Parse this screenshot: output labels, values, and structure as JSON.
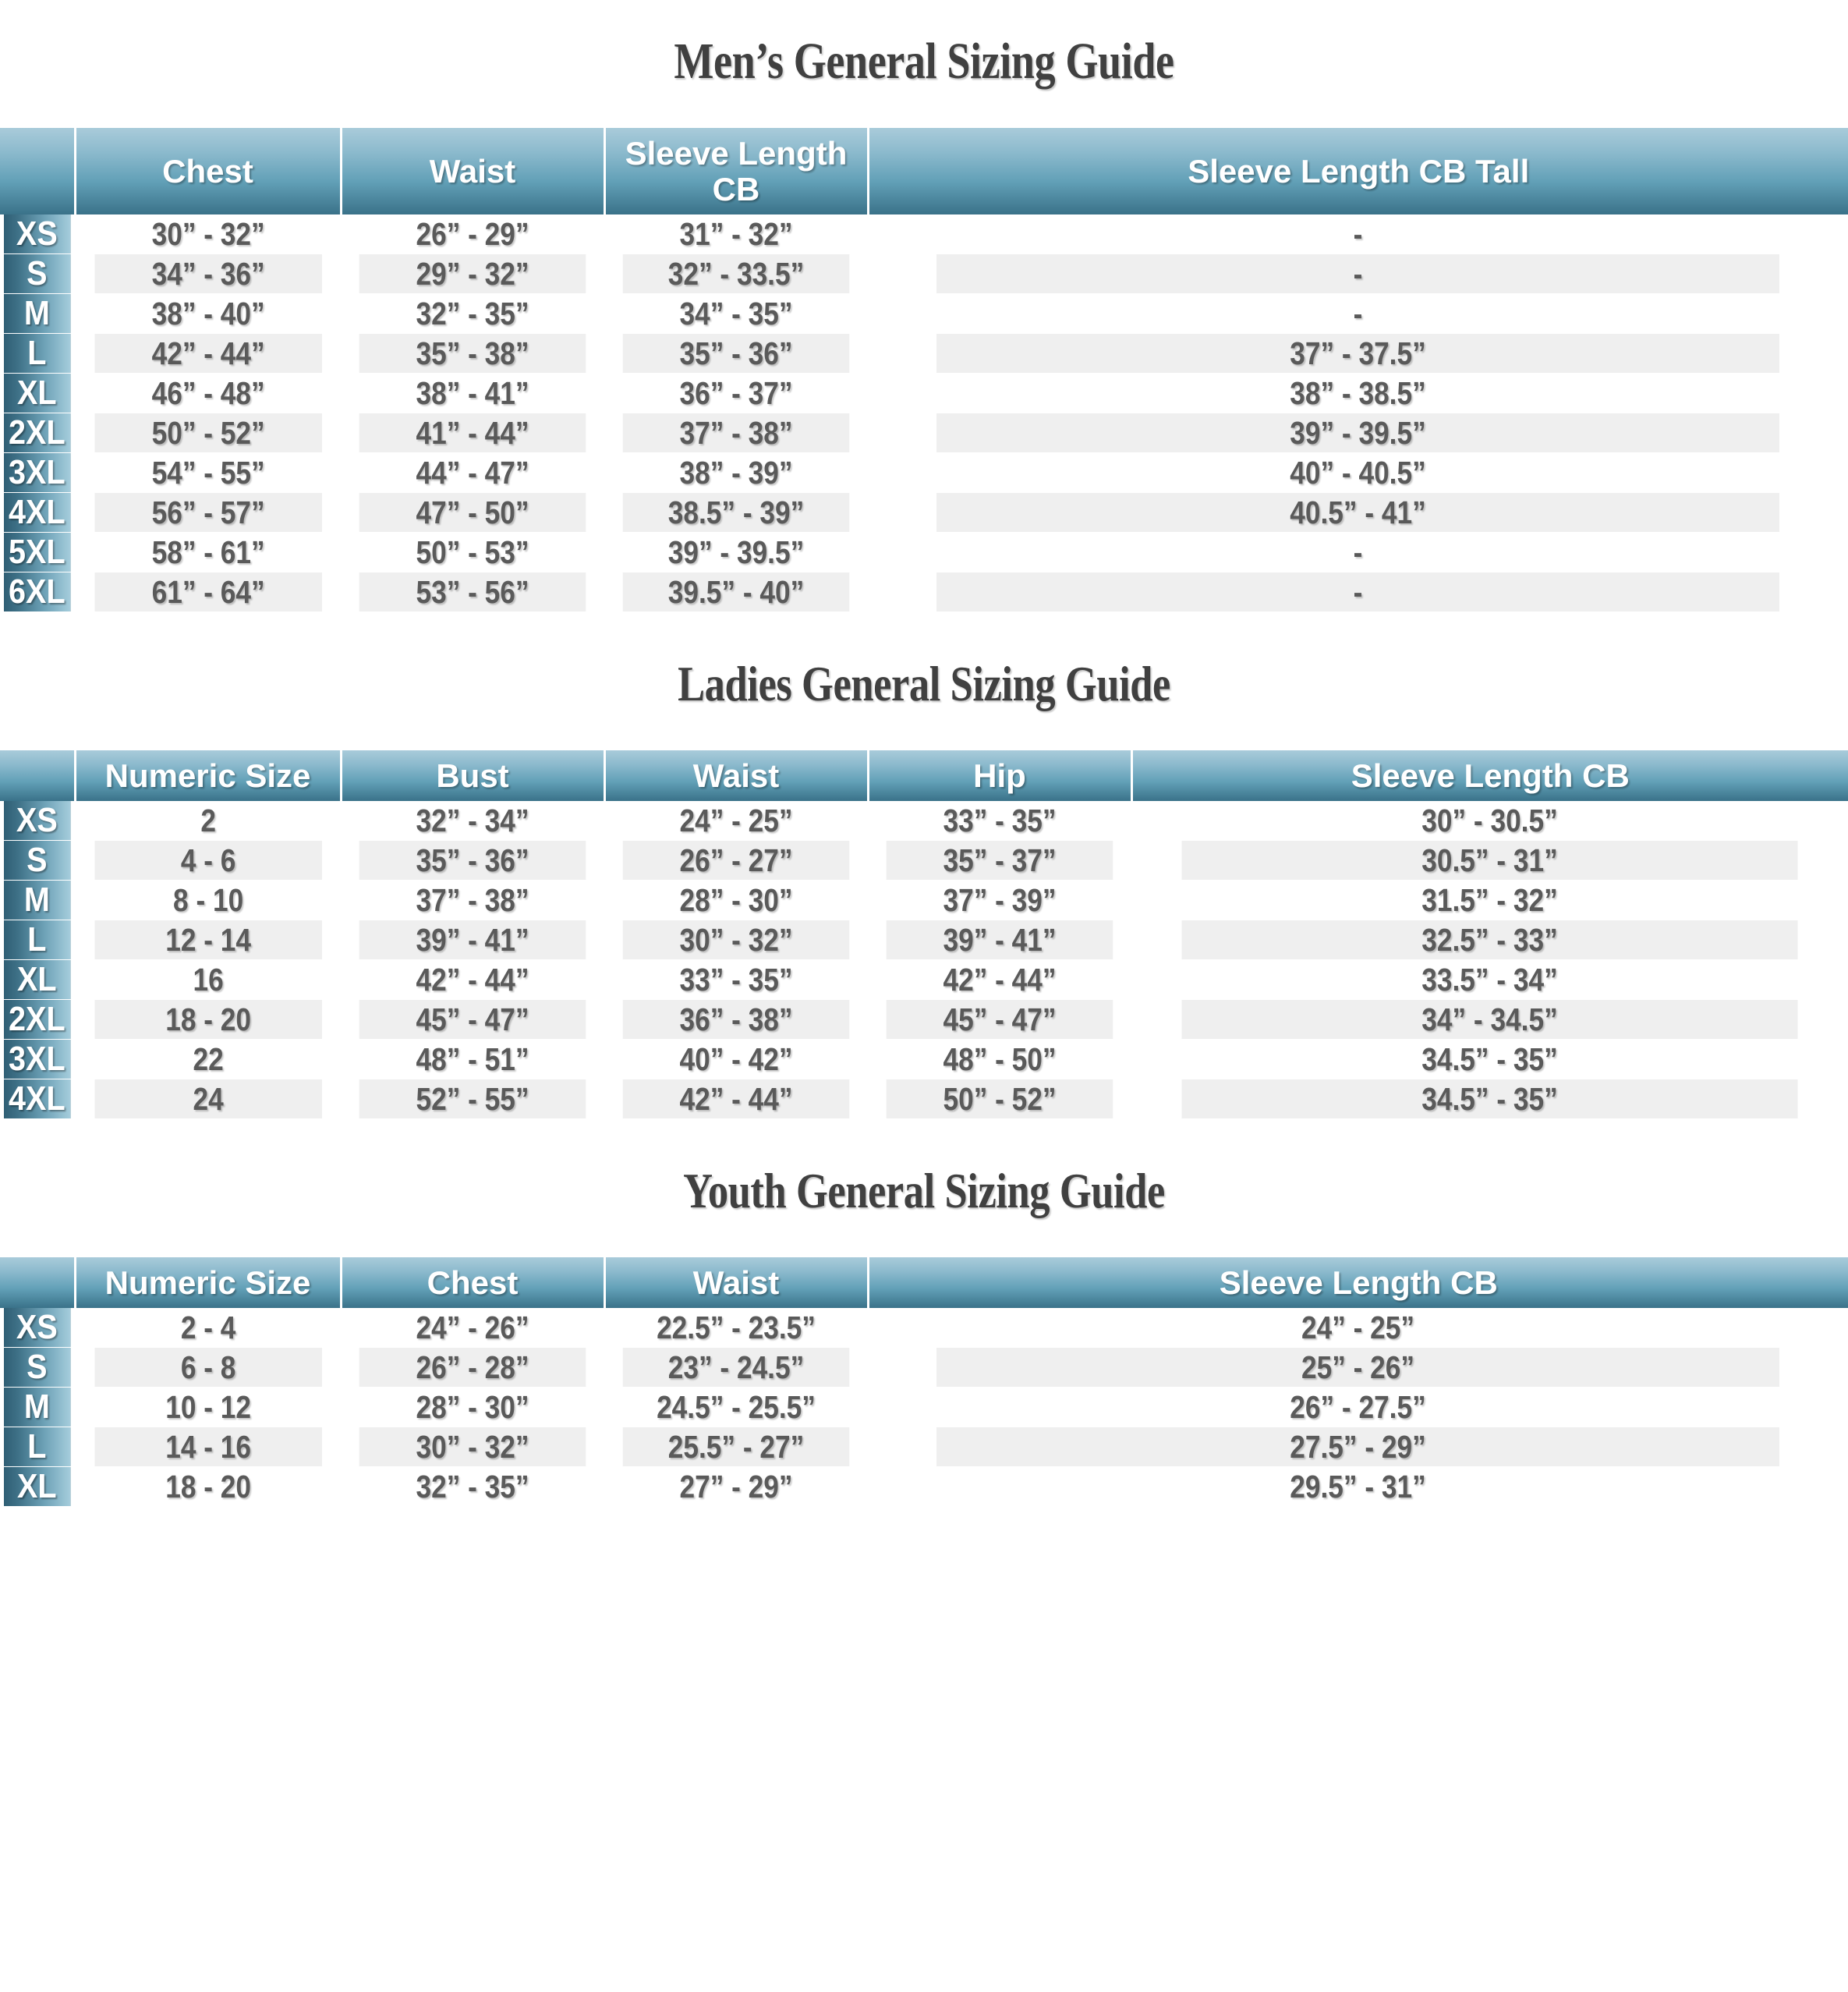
{
  "theme": {
    "header_gradient_top": "#a9cbda",
    "header_gradient_bottom": "#3a7289",
    "size_cell_gradient_left": "#2f5e74",
    "size_cell_gradient_right": "#a5cddc",
    "body_text_color": "#5a5a5a",
    "row_alt_color": "#efefef",
    "title_color": "#404040"
  },
  "sections": [
    {
      "id": "mens",
      "title": "Men’s General Sizing Guide",
      "corner_header": "",
      "columns": [
        "Chest",
        "Waist",
        "Sleeve Length CB",
        "Sleeve Length CB Tall"
      ],
      "rows": [
        {
          "size": "XS",
          "cells": [
            "30” - 32”",
            "26” - 29”",
            "31” - 32”",
            "-"
          ]
        },
        {
          "size": "S",
          "cells": [
            "34” - 36”",
            "29” - 32”",
            "32” - 33.5”",
            "-"
          ]
        },
        {
          "size": "M",
          "cells": [
            "38” - 40”",
            "32” - 35”",
            "34” - 35”",
            "-"
          ]
        },
        {
          "size": "L",
          "cells": [
            "42” - 44”",
            "35” - 38”",
            "35” - 36”",
            "37” - 37.5”"
          ]
        },
        {
          "size": "XL",
          "cells": [
            "46” - 48”",
            "38” - 41”",
            "36” - 37”",
            "38” - 38.5”"
          ]
        },
        {
          "size": "2XL",
          "cells": [
            "50” - 52”",
            "41” - 44”",
            "37” - 38”",
            "39” - 39.5”"
          ]
        },
        {
          "size": "3XL",
          "cells": [
            "54” - 55”",
            "44” - 47”",
            "38” - 39”",
            "40” - 40.5”"
          ]
        },
        {
          "size": "4XL",
          "cells": [
            "56” - 57”",
            "47” - 50”",
            "38.5” - 39”",
            "40.5” - 41”"
          ]
        },
        {
          "size": "5XL",
          "cells": [
            "58” - 61”",
            "50” - 53”",
            "39” - 39.5”",
            "-"
          ]
        },
        {
          "size": "6XL",
          "cells": [
            "61” - 64”",
            "53” - 56”",
            "39.5” - 40”",
            "-"
          ]
        }
      ]
    },
    {
      "id": "ladies",
      "title": "Ladies General Sizing Guide",
      "corner_header": "",
      "columns": [
        "Numeric Size",
        "Bust",
        "Waist",
        "Hip",
        "Sleeve Length CB"
      ],
      "rows": [
        {
          "size": "XS",
          "cells": [
            "2",
            "32” - 34”",
            "24” - 25”",
            "33” - 35”",
            "30” - 30.5”"
          ]
        },
        {
          "size": "S",
          "cells": [
            "4 - 6",
            "35” - 36”",
            "26” - 27”",
            "35” - 37”",
            "30.5” - 31”"
          ]
        },
        {
          "size": "M",
          "cells": [
            "8 - 10",
            "37” - 38”",
            "28” - 30”",
            "37” - 39”",
            "31.5” - 32”"
          ]
        },
        {
          "size": "L",
          "cells": [
            "12 - 14",
            "39” - 41”",
            "30” - 32”",
            "39” - 41”",
            "32.5” - 33”"
          ]
        },
        {
          "size": "XL",
          "cells": [
            "16",
            "42” - 44”",
            "33” - 35”",
            "42” - 44”",
            "33.5” - 34”"
          ]
        },
        {
          "size": "2XL",
          "cells": [
            "18 - 20",
            "45” - 47”",
            "36” - 38”",
            "45” - 47”",
            "34” - 34.5”"
          ]
        },
        {
          "size": "3XL",
          "cells": [
            "22",
            "48” - 51”",
            "40” - 42”",
            "48” - 50”",
            "34.5” - 35”"
          ]
        },
        {
          "size": "4XL",
          "cells": [
            "24",
            "52” - 55”",
            "42” - 44”",
            "50” - 52”",
            "34.5” - 35”"
          ]
        }
      ]
    },
    {
      "id": "youth",
      "title": "Youth General Sizing Guide",
      "corner_header": "",
      "columns": [
        "Numeric Size",
        "Chest",
        "Waist",
        "Sleeve Length CB"
      ],
      "rows": [
        {
          "size": "XS",
          "cells": [
            "2 - 4",
            "24” - 26”",
            "22.5” - 23.5”",
            "24” - 25”"
          ]
        },
        {
          "size": "S",
          "cells": [
            "6 - 8",
            "26” - 28”",
            "23” - 24.5”",
            "25” - 26”"
          ]
        },
        {
          "size": "M",
          "cells": [
            "10 - 12",
            "28” - 30”",
            "24.5” - 25.5”",
            "26” - 27.5”"
          ]
        },
        {
          "size": "L",
          "cells": [
            "14 - 16",
            "30” - 32”",
            "25.5” - 27”",
            "27.5” - 29”"
          ]
        },
        {
          "size": "XL",
          "cells": [
            "18 - 20",
            "32” - 35”",
            "27” - 29”",
            "29.5” - 31”"
          ]
        }
      ]
    }
  ]
}
